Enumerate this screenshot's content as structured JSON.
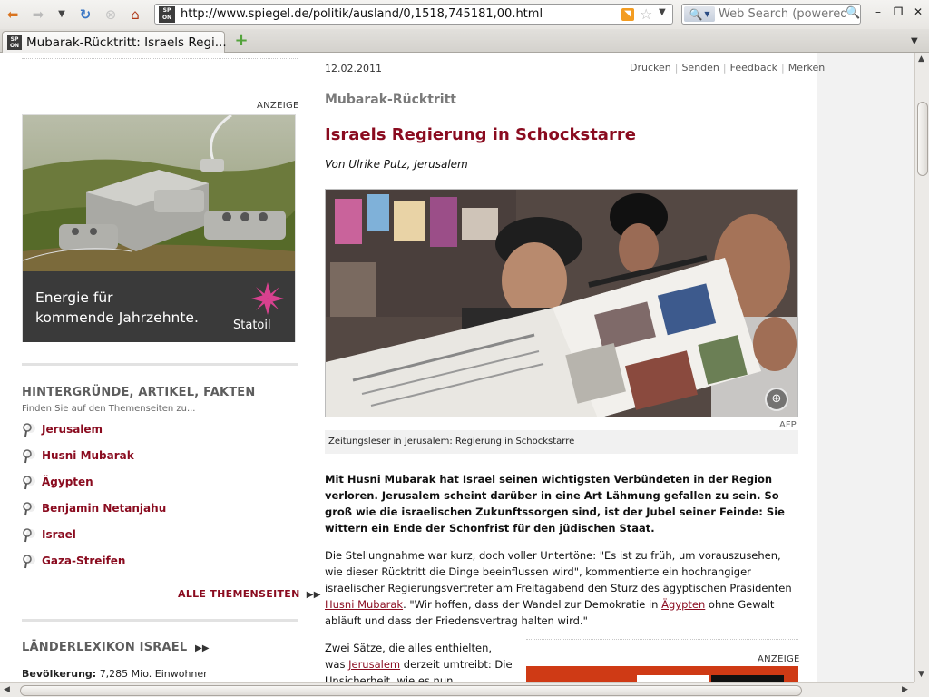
{
  "browser": {
    "url": "http://www.spiegel.de/politik/ausland/0,1518,745181,00.html",
    "search_placeholder": "Web Search (powered",
    "tab_title": "Mubarak-Rücktritt: Israels Regi...",
    "favicon_text_top": "SP",
    "favicon_text_bottom": "ON"
  },
  "sidebar": {
    "ad_label": "ANZEIGE",
    "ad_slogan_line1": "Energie für",
    "ad_slogan_line2": "kommende Jahrzehnte.",
    "ad_brand": "Statoil",
    "themen_heading": "HINTERGRÜNDE, ARTIKEL, FAKTEN",
    "themen_subheading": "Finden Sie auf den Themenseiten zu...",
    "themen": [
      {
        "label": "Jerusalem"
      },
      {
        "label": "Husni Mubarak"
      },
      {
        "label": "Ägypten"
      },
      {
        "label": "Benjamin Netanjahu"
      },
      {
        "label": "Israel"
      },
      {
        "label": "Gaza-Streifen"
      }
    ],
    "alle_themen": "ALLE THEMENSEITEN",
    "laender_heading": "LÄNDERLEXIKON ISRAEL",
    "bevoelkerung_label": "Bevölkerung:",
    "bevoelkerung_value": "7,285 Mio. Einwohner"
  },
  "article": {
    "date": "12.02.2011",
    "tools": [
      "Drucken",
      "Senden",
      "Feedback",
      "Merken"
    ],
    "kicker": "Mubarak-Rücktritt",
    "headline": "Israels Regierung in Schockstarre",
    "byline": "Von Ulrike Putz, Jerusalem",
    "photo_credit": "AFP",
    "caption": "Zeitungsleser in Jerusalem: Regierung in Schockstarre",
    "lead": "Mit Husni Mubarak hat Israel seinen wichtigsten Verbündeten in der Region verloren. Jerusalem scheint darüber in eine Art Lähmung gefallen zu sein. So groß wie die israelischen Zukunftssorgen sind, ist der Jubel seiner Feinde: Sie wittern ein Ende der Schonfrist für den jüdischen Staat.",
    "body1_part1": "Die Stellungnahme war kurz, doch voller Untertöne: \"Es ist zu früh, um vorauszusehen, wie dieser Rücktritt die Dinge beeinflussen wird\", kommentierte ein hochrangiger israelischer Regierungsvertreter am Freitagabend den Sturz des ägyptischen Präsidenten ",
    "body1_link1": "Husni Mubarak",
    "body1_part2": ". \"Wir hoffen, dass der Wandel zur Demokratie in ",
    "body1_link2": "Ägypten",
    "body1_part3": " ohne Gewalt abläuft und dass der Friedensvertrag halten wird.\"",
    "body2_part1": "Zwei Sätze, die alles enthielten, was ",
    "body2_link": "Jerusalem",
    "body2_part2": " derzeit umtreibt: Die Unsicherheit, wie es nun weitergehen",
    "ad2_label": "ANZEIGE"
  }
}
